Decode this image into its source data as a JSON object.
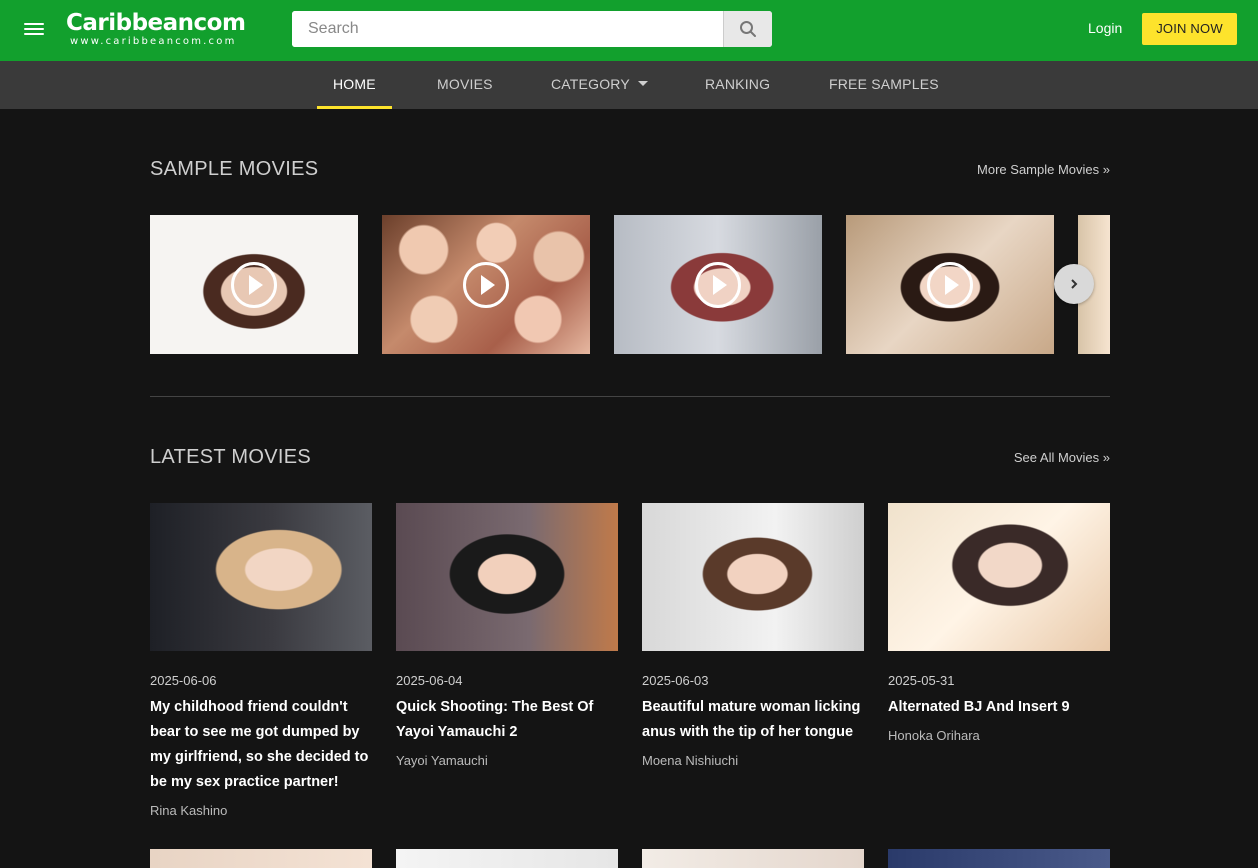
{
  "header": {
    "logo_main": "Caribbeancom",
    "logo_sub": "www.caribbeancom.com",
    "search_placeholder": "Search",
    "login_label": "Login",
    "join_label": "JOIN NOW",
    "brand_color": "#12a02d",
    "join_color": "#fde32c"
  },
  "nav": {
    "items": [
      {
        "label": "HOME",
        "active": true
      },
      {
        "label": "MOVIES"
      },
      {
        "label": "CATEGORY"
      },
      {
        "label": "RANKING"
      },
      {
        "label": "FREE SAMPLES"
      }
    ]
  },
  "sample_movies": {
    "title": "SAMPLE MOVIES",
    "more_link": "More Sample Movies »",
    "icons": {
      "play": "play-circle-icon",
      "next": "chevron-right-icon"
    }
  },
  "latest_movies": {
    "title": "LATEST MOVIES",
    "more_link": "See All Movies »",
    "items": [
      {
        "date": "2025-06-06",
        "title": "My childhood friend couldn't bear to see me got dumped by my girlfriend, so she decided to be my sex practice partner!",
        "actress": "Rina Kashino"
      },
      {
        "date": "2025-06-04",
        "title": "Quick Shooting: The Best Of Yayoi Yamauchi 2",
        "actress": "Yayoi Yamauchi"
      },
      {
        "date": "2025-06-03",
        "title": "Beautiful mature woman licking anus with the tip of her tongue",
        "actress": "Moena Nishiuchi"
      },
      {
        "date": "2025-05-31",
        "title": "Alternated BJ And Insert 9",
        "actress": "Honoka Orihara"
      }
    ]
  }
}
